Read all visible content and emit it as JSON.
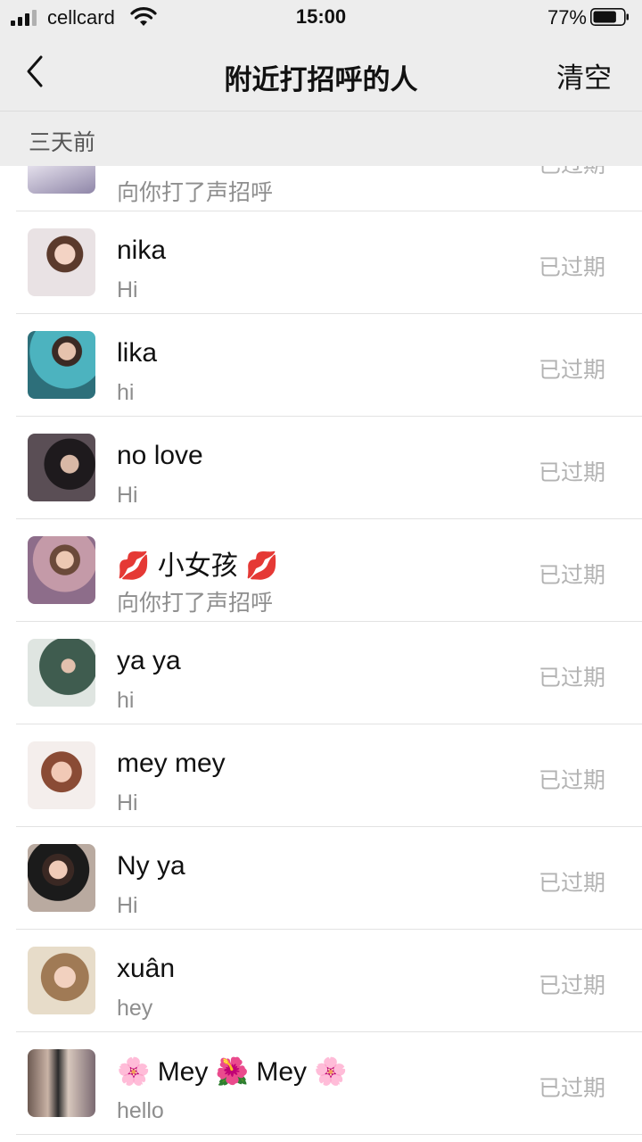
{
  "status_bar": {
    "carrier": "cellcard",
    "time": "15:00",
    "battery_percent": "77%",
    "battery_level": 0.77
  },
  "nav": {
    "title": "附近打招呼的人",
    "clear_label": "清空",
    "back_icon": "chevron-left-icon"
  },
  "section": {
    "label": "三天前"
  },
  "partial_item": {
    "message": "向你打了声招呼",
    "status": "已过期"
  },
  "items": [
    {
      "name": "nika",
      "message": "Hi",
      "status": "已过期"
    },
    {
      "name": "lika",
      "message": "hi",
      "status": "已过期"
    },
    {
      "name": "no love",
      "message": "Hi",
      "status": "已过期"
    },
    {
      "name": "💋 小女孩 💋",
      "message": "向你打了声招呼",
      "status": "已过期"
    },
    {
      "name": "ya ya",
      "message": "hi",
      "status": "已过期"
    },
    {
      "name": "mey mey",
      "message": "Hi",
      "status": "已过期"
    },
    {
      "name": "Ny ya",
      "message": "Hi",
      "status": "已过期"
    },
    {
      "name": "xuân",
      "message": "hey",
      "status": "已过期"
    },
    {
      "name": "🌸 Mey 🌺 Mey 🌸",
      "message": "hello",
      "status": "已过期"
    }
  ],
  "colors": {
    "header_bg": "#ededed",
    "meta_text": "#b3b3b3",
    "message_text": "#8e8e8e"
  }
}
